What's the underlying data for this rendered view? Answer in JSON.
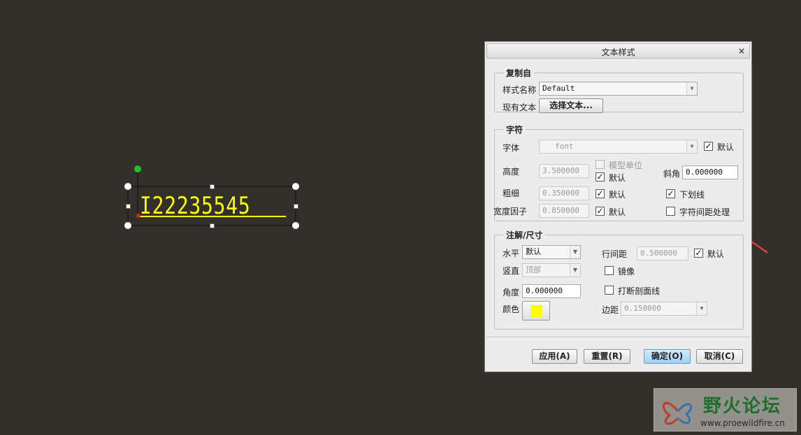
{
  "canvas": {
    "annotation_text": "I22235545",
    "annotation_color": "#ffff00",
    "background": "#333029"
  },
  "dialog": {
    "title": "文本样式",
    "close_label": "×",
    "copy_from": {
      "group_title": "复制自",
      "style_name_label": "样式名称",
      "style_name_value": "Default",
      "existing_text_label": "现有文本",
      "select_text_button": "选择文本..."
    },
    "character": {
      "group_title": "字符",
      "font_label": "字体",
      "font_value": "font",
      "font_default_checked": true,
      "font_default_label": "默认",
      "height_label": "高度",
      "height_value": "3.500000",
      "model_units_label": "模型单位",
      "model_units_checked": false,
      "height_default_label": "默认",
      "height_default_checked": true,
      "slant_label": "斜角",
      "slant_value": "0.000000",
      "thickness_label": "粗细",
      "thickness_value": "0.350000",
      "thickness_default_label": "默认",
      "thickness_default_checked": true,
      "underline_label": "下划线",
      "underline_checked": true,
      "width_factor_label": "宽度因子",
      "width_factor_value": "0.850000",
      "width_default_label": "默认",
      "width_default_checked": true,
      "kerning_label": "字符间距处理",
      "kerning_checked": false
    },
    "note_dim": {
      "group_title": "注解/尺寸",
      "horizontal_label": "水平",
      "horizontal_value": "默认",
      "vertical_label": "竖直",
      "vertical_value": "顶部",
      "angle_label": "角度",
      "angle_value": "0.000000",
      "color_label": "颜色",
      "color_value": "#ffff00",
      "line_spacing_label": "行间距",
      "line_spacing_value": "0.500000",
      "line_spacing_default_label": "默认",
      "line_spacing_default_checked": true,
      "mirror_label": "镜像",
      "mirror_checked": false,
      "break_hatch_label": "打断剖面线",
      "break_hatch_checked": false,
      "margin_label": "边距",
      "margin_value": "0.150000"
    },
    "buttons": {
      "apply": "应用(A)",
      "reset": "重置(R)",
      "ok": "确定(O)",
      "cancel": "取消(C)"
    }
  },
  "watermark": {
    "title": "野火论坛",
    "url": "www.proewildfire.cn"
  },
  "colors": {
    "arrow": "#e83a3a",
    "ok_button": "#9fd0f5"
  }
}
